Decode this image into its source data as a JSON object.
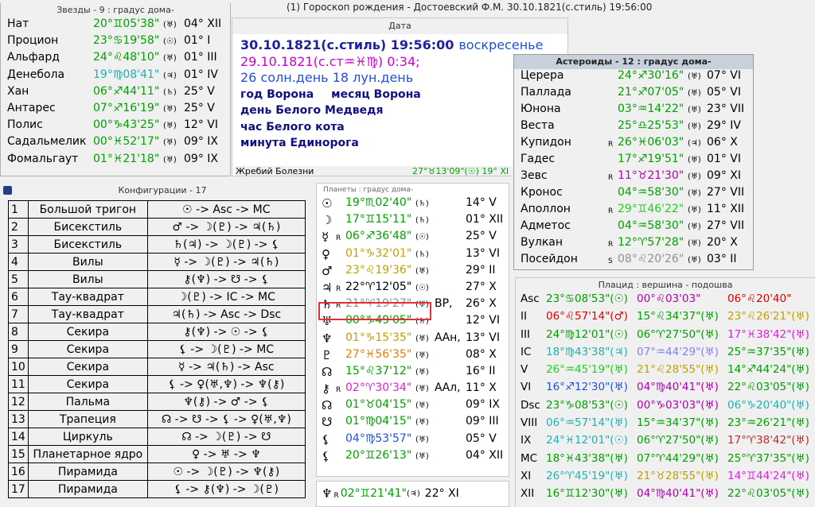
{
  "window": {
    "title": "(1) Гороскоп рождения - Достоевский Ф.М. 30.10.1821(с.стиль)  19:56:00"
  },
  "stars": {
    "title": "Звезды - 9 : градус дома-",
    "rows": [
      {
        "name": "Нат",
        "pos": "20°♊05'38\"",
        "asp": "(♅)",
        "house": "04° XII",
        "color": "#00a000"
      },
      {
        "name": "Процион",
        "pos": "23°♋19'58\"",
        "asp": "(☉)",
        "house": "01° I",
        "color": "#00a000"
      },
      {
        "name": "Альфард",
        "pos": "24°♌48'10\"",
        "asp": "(♅)",
        "house": "01° III",
        "color": "#00a000"
      },
      {
        "name": "Денебола",
        "pos": "19°♍08'41\"",
        "asp": "(♃)",
        "house": "01° IV",
        "color": "#20b0b0"
      },
      {
        "name": "Хан",
        "pos": "06°♐44'11\"",
        "asp": "(♄)",
        "house": "25° V",
        "color": "#00a000"
      },
      {
        "name": "Антарес",
        "pos": "07°♐16'19\"",
        "asp": "(♅)",
        "house": "25° V",
        "color": "#00a000"
      },
      {
        "name": "Полис",
        "pos": "00°♑43'25\"",
        "asp": "(♅)",
        "house": "12° VI",
        "color": "#00a000"
      },
      {
        "name": "Садальмелик",
        "pos": "00°♓52'17\"",
        "asp": "(♅)",
        "house": "09° IX",
        "color": "#00a000"
      },
      {
        "name": "Фомальгаут",
        "pos": "01°♓21'18\"",
        "asp": "(♅)",
        "house": "09° IX",
        "color": "#00a000"
      }
    ]
  },
  "date": {
    "title": "Дата",
    "line1": "30.10.1821(с.стиль)  19:56:00",
    "weekday": "воскресенье",
    "line2": "29.10.1821(с.ст♒♓♍)  0:34;",
    "line3": "26 солн.день 18 лун.день",
    "line4a": "год Ворона",
    "line4b": "месяц Ворона",
    "line5": "день Белого Медведя",
    "line6": "час Белого кота",
    "line7": "минута Единорога",
    "lot": "Жребий Болезни",
    "lot_pos": "27°♉13'09\"(☉) 19° XI"
  },
  "asteroids": {
    "title": "Астероиды - 12 : градус дома-",
    "rows": [
      {
        "name": "Церера",
        "r": "",
        "pos": "24°♐30'16\"",
        "asp": "(♅)",
        "house": "07° VI",
        "color": "#00a000"
      },
      {
        "name": "Паллада",
        "r": "",
        "pos": "21°♐07'05\"",
        "asp": "(♅)",
        "house": "05° VI",
        "color": "#00a000"
      },
      {
        "name": "Юнона",
        "r": "",
        "pos": "03°♒14'22\"",
        "asp": "(♅)",
        "house": "23° VII",
        "color": "#00a000"
      },
      {
        "name": "Веста",
        "r": "",
        "pos": "25°♎25'53\"",
        "asp": "(♅)",
        "house": "29° IV",
        "color": "#00a000"
      },
      {
        "name": "Купидон",
        "r": "R",
        "pos": "26°♓06'03\"",
        "asp": "(♃)",
        "house": "06° X",
        "color": "#00a000"
      },
      {
        "name": "Гадес",
        "r": "",
        "pos": "17°♐19'51\"",
        "asp": "(♅)",
        "house": "01° VI",
        "color": "#00a000"
      },
      {
        "name": "Зевс",
        "r": "R",
        "pos": "11°♉21'30\"",
        "asp": "(♅)",
        "house": "09° XI",
        "color": "#b000b0"
      },
      {
        "name": "Кронос",
        "r": "",
        "pos": "04°♒58'30\"",
        "asp": "(♅)",
        "house": "27° VII",
        "color": "#00a000"
      },
      {
        "name": "Аполлон",
        "r": "R",
        "pos": "29°♊46'22\"",
        "asp": "(♅)",
        "house": "11° XII",
        "color": "#20d020"
      },
      {
        "name": "Адметос",
        "r": "",
        "pos": "04°♒58'30\"",
        "asp": "(♅)",
        "house": "27° VII",
        "color": "#00a000"
      },
      {
        "name": "Вулкан",
        "r": "R",
        "pos": "12°♈57'28\"",
        "asp": "(♅)",
        "house": "20° X",
        "color": "#00a000"
      },
      {
        "name": "Посейдон",
        "r": "S",
        "pos": "08°♌20'26\"",
        "asp": "(♅)",
        "house": "03° II",
        "color": "#909090"
      }
    ]
  },
  "config": {
    "title": "Конфигурации - 17",
    "rows": [
      {
        "n": "1",
        "name": "Большой тригон",
        "f": "☉ -> Asc -> MC"
      },
      {
        "n": "2",
        "name": "Бисекстиль",
        "f": "♂ -> ☽(♇) -> ♃(♄)"
      },
      {
        "n": "3",
        "name": "Бисекстиль",
        "f": "♄(♃) -> ☽(♇) -> ⚸"
      },
      {
        "n": "4",
        "name": "Вилы",
        "f": "☿ -> ☽(♇) -> ♃(♄)"
      },
      {
        "n": "5",
        "name": "Вилы",
        "f": "⚷(♆) -> ☋ -> ⚸"
      },
      {
        "n": "6",
        "name": "Тау-квадрат",
        "f": "☽(♇) -> IC -> MC"
      },
      {
        "n": "7",
        "name": "Тау-квадрат",
        "f": "♃(♄) -> Asc -> Dsc"
      },
      {
        "n": "8",
        "name": "Секира",
        "f": "⚷(♆) -> ☉ -> ⚸"
      },
      {
        "n": "9",
        "name": "Секира",
        "f": "⚸ -> ☽(♇) -> MC"
      },
      {
        "n": "10",
        "name": "Секира",
        "f": "☿ -> ♃(♄) -> Asc"
      },
      {
        "n": "11",
        "name": "Секира",
        "f": "⚸ -> ♀(♅,♆) -> ♆(⚷)"
      },
      {
        "n": "12",
        "name": "Пальма",
        "f": "♆(⚷) -> ♂ -> ⚸"
      },
      {
        "n": "13",
        "name": "Трапеция",
        "f": "☊ -> ☋ -> ⚸ -> ♀(♅,♆)"
      },
      {
        "n": "14",
        "name": "Циркуль",
        "f": "☊ -> ☽(♇) -> ☋"
      },
      {
        "n": "15",
        "name": "Планетарное ядро",
        "f": "♀ -> ♅ -> ♆"
      },
      {
        "n": "16",
        "name": "Пирамида",
        "f": "☉ -> ☽(♇) -> ♆(⚷)"
      },
      {
        "n": "17",
        "name": "Пирамида",
        "f": "⚸ -> ⚷(♆) -> ☽(♇)"
      }
    ]
  },
  "planets": {
    "title": "Планеты : градус дома-",
    "rows": [
      {
        "g": "☉",
        "r": "",
        "pos": "19°♏02'40\"",
        "asp": "(♄)",
        "extra": "",
        "house": "14° V",
        "color": "#00a000"
      },
      {
        "g": "☽",
        "r": "",
        "pos": "17°♊15'11\"",
        "asp": "(♄)",
        "extra": "",
        "house": "01° XII",
        "color": "#00a000"
      },
      {
        "g": "☿",
        "r": "R",
        "pos": "06°♐36'48\"",
        "asp": "(☉)",
        "extra": "",
        "house": "25° V",
        "color": "#00a000"
      },
      {
        "g": "♀",
        "r": "",
        "pos": "01°♑32'01\"",
        "asp": "(♄)",
        "extra": "",
        "house": "13° VI",
        "color": "#c0a000"
      },
      {
        "g": "♂",
        "r": "",
        "pos": "23°♌19'36\"",
        "asp": "(♅)",
        "extra": "",
        "house": "29° II",
        "color": "#c0a000"
      },
      {
        "g": "♃",
        "r": "R",
        "pos": "22°♈12'05\"",
        "asp": "(☉)",
        "extra": "",
        "house": "27° X",
        "color": "#000000"
      },
      {
        "g": "♄",
        "r": "R",
        "pos": "21°♈19'27\"",
        "asp": "(♅)",
        "extra": "ВР,",
        "house": "26° X",
        "color": "#909090"
      },
      {
        "g": "♅",
        "r": "",
        "pos": "00°♑49'05\"",
        "asp": "(♄)",
        "extra": "",
        "house": "12° VI",
        "color": "#00a000"
      },
      {
        "g": "♆",
        "r": "",
        "pos": "01°♑15'35\"",
        "asp": "(♅)",
        "extra": "ААн,",
        "house": "13° VI",
        "color": "#c0a000"
      },
      {
        "g": "♇",
        "r": "",
        "pos": "27°♓56'35\"",
        "asp": "(♅)",
        "extra": "",
        "house": "08° X",
        "color": "#e08000"
      },
      {
        "g": "☊",
        "r": "",
        "pos": "15°♌37'12\"",
        "asp": "(♅)",
        "extra": "",
        "house": "16° II",
        "color": "#00a000"
      },
      {
        "g": "⚷",
        "r": "R",
        "pos": "02°♈30'34\"",
        "asp": "(♅)",
        "extra": "ААл,",
        "house": "11° X",
        "color": "#e020e0"
      },
      {
        "g": "☊",
        "r": "",
        "pos": "01°♉04'15\"",
        "asp": "(♅)",
        "extra": "",
        "house": "09° IX",
        "color": "#00a000"
      },
      {
        "g": "☋",
        "r": "",
        "pos": "01°♍04'15\"",
        "asp": "(♅)",
        "extra": "",
        "house": "09° III",
        "color": "#00a000"
      },
      {
        "g": "⚸",
        "r": "",
        "pos": "04°♍53'57\"",
        "asp": "(♅)",
        "extra": "",
        "house": "05° V",
        "color": "#2050e0"
      },
      {
        "g": "⚸",
        "r": "",
        "pos": "20°♊26'13\"",
        "asp": "(♅)",
        "extra": "",
        "house": "04° XII",
        "color": "#00a000"
      }
    ],
    "footer": {
      "g": "♆",
      "r": "R",
      "pos": "02°♊21'41\"",
      "asp": "(♃)",
      "house": "22° XI",
      "color": "#00a000"
    }
  },
  "placidus": {
    "title": "Плацид : вершина - подошва",
    "rows": [
      {
        "name": "Asc",
        "a": "23°♋08'53\"(☉)",
        "ac": "#00a000",
        "b": "00°♌03'03\"",
        "bc": "#b000b0",
        "c": "06°♌20'40\"",
        "cc": "#e00000"
      },
      {
        "name": "II",
        "a": "06°♌57'14\"(♂)",
        "ac": "#e00000",
        "b": "15°♌34'37\"(♅)",
        "bc": "#00a000",
        "c": "23°♌26'21\"(♅)",
        "cc": "#c0a000"
      },
      {
        "name": "III",
        "a": "24°♍12'01\"(☉)",
        "ac": "#00a000",
        "b": "06°♈27'50\"(♅)",
        "bc": "#00a000",
        "c": "17°♓38'42\"(♅)",
        "cc": "#e020e0"
      },
      {
        "name": "IC",
        "a": "18°♍43'38\"(♃)",
        "ac": "#20b0b0",
        "b": "07°♒44'29\"(♅)",
        "bc": "#8080ff",
        "c": "25°♒37'35\"(♅)",
        "cc": "#00a000"
      },
      {
        "name": "V",
        "a": "26°♒45'19\"(♅)",
        "ac": "#20d020",
        "b": "21°♌28'55\"(♅)",
        "bc": "#c0a000",
        "c": "14°♐44'24\"(♅)",
        "cc": "#00a000"
      },
      {
        "name": "VI",
        "a": "16°♐12'30\"(♅)",
        "ac": "#2050e0",
        "b": "04°♍40'41\"(♅)",
        "bc": "#b000b0",
        "c": "22°♌03'05\"(♅)",
        "cc": "#00a000"
      },
      {
        "name": "Dsc",
        "a": "23°♑08'53\"(☉)",
        "ac": "#00a000",
        "b": "00°♑03'03\"(♅)",
        "bc": "#b000b0",
        "c": "06°♑20'40\"(♅)",
        "cc": "#20b0b0"
      },
      {
        "name": "VIII",
        "a": "06°♒57'14\"(♅)",
        "ac": "#20b0b0",
        "b": "15°♒34'37\"(♅)",
        "bc": "#00a000",
        "c": "23°♒26'21\"(♅)",
        "cc": "#00a000"
      },
      {
        "name": "IX",
        "a": "24°♓12'01\"(☉)",
        "ac": "#20b0b0",
        "b": "06°♈27'50\"(♅)",
        "bc": "#00a000",
        "c": "17°♈38'42\"(♅)",
        "cc": "#b03030"
      },
      {
        "name": "MC",
        "a": "18°♓43'38\"(♅)",
        "ac": "#00a000",
        "b": "07°♈44'29\"(♅)",
        "bc": "#00a000",
        "c": "25°♈37'35\"(♅)",
        "cc": "#00a000"
      },
      {
        "name": "XI",
        "a": "26°♈45'19\"(♅)",
        "ac": "#20b0b0",
        "b": "21°♉28'55\"(♅)",
        "bc": "#c0a000",
        "c": "14°♊44'24\"(♅)",
        "cc": "#e020e0"
      },
      {
        "name": "XII",
        "a": "16°♊12'30\"(♅)",
        "ac": "#00a000",
        "b": "04°♍40'41\"(♅)",
        "bc": "#b000b0",
        "c": "22°♌03'05\"(♅)",
        "cc": "#00a000"
      }
    ]
  }
}
